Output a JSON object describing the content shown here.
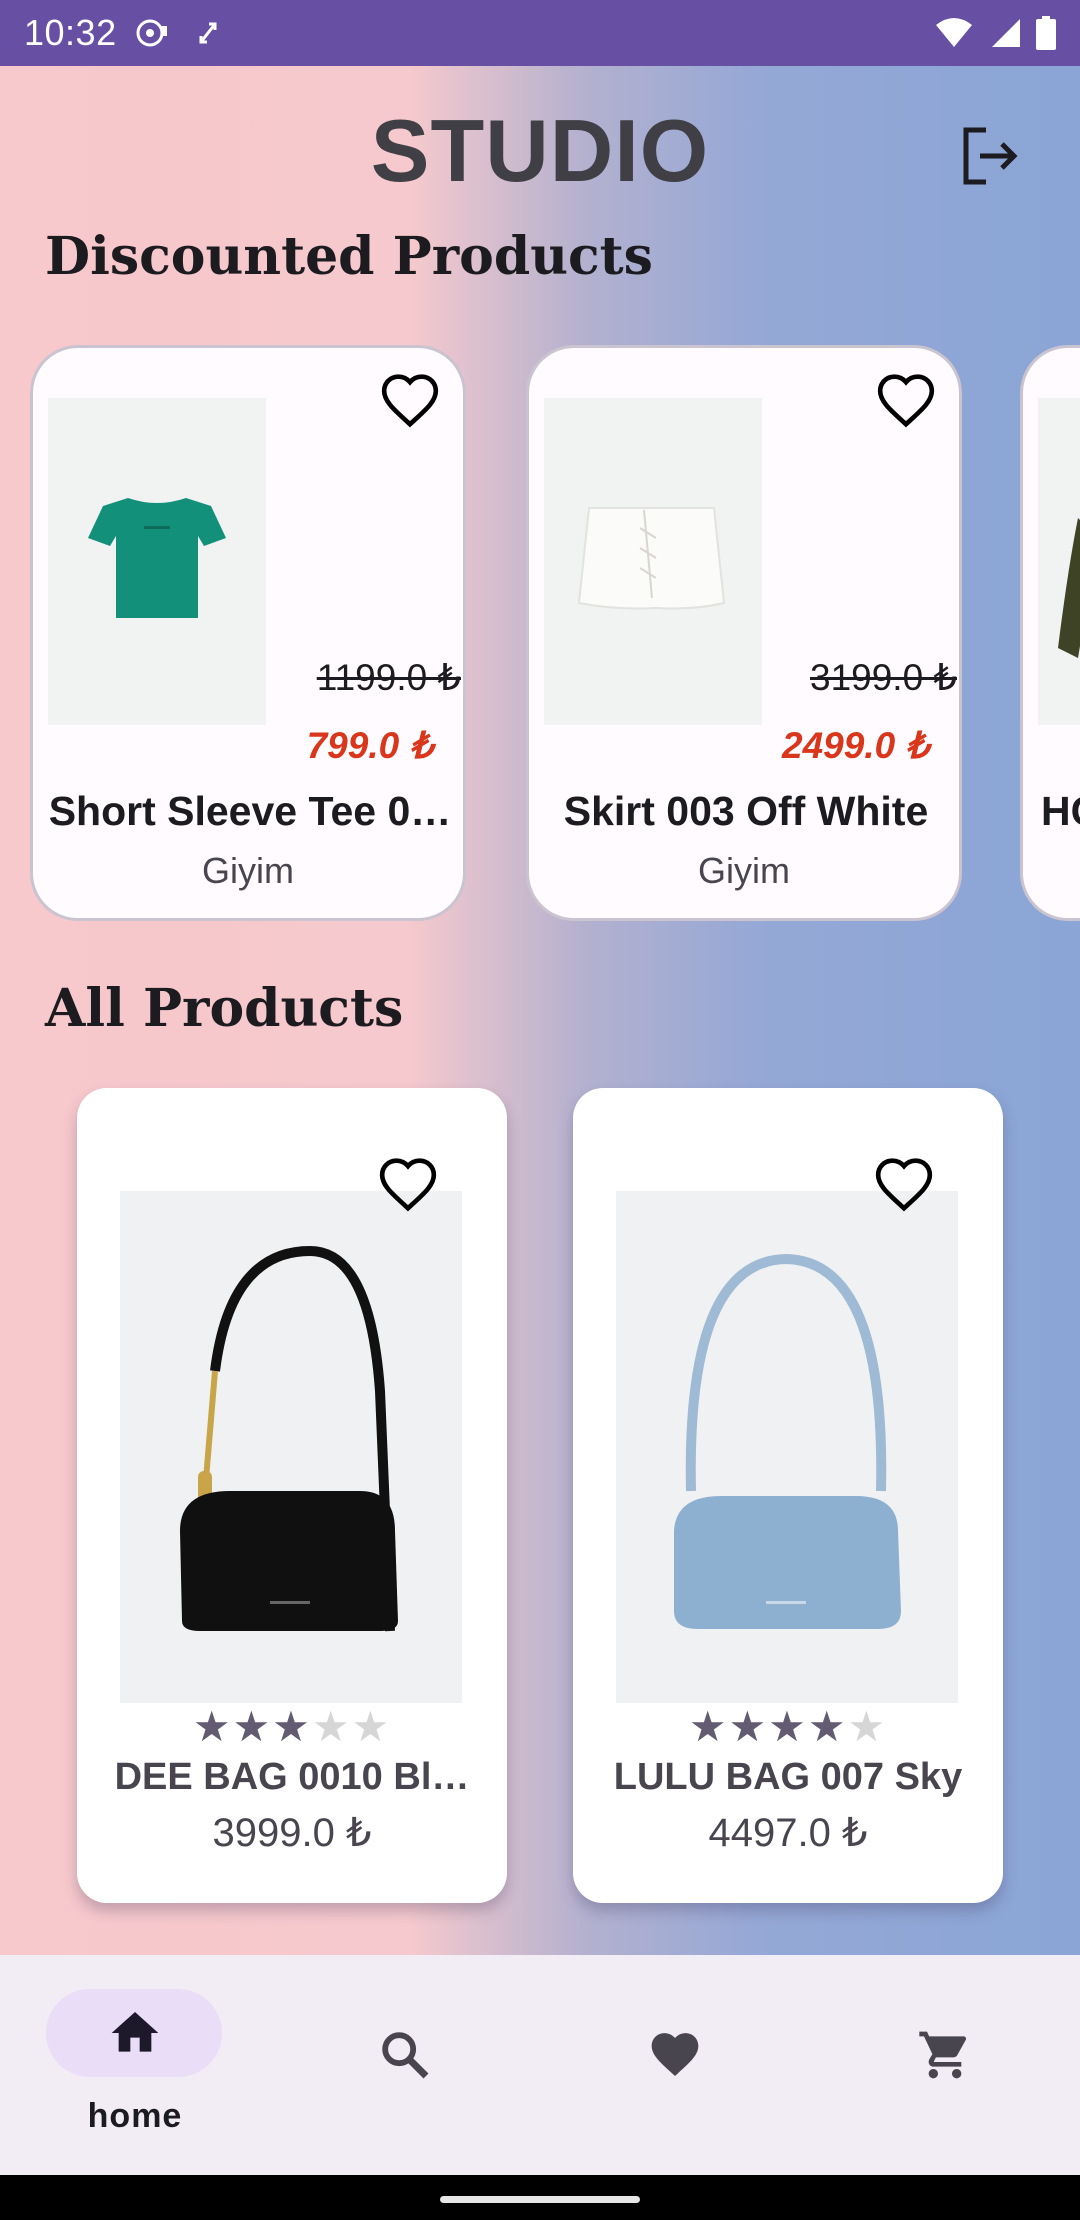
{
  "status_bar": {
    "time": "10:32",
    "icons": [
      "media-icon",
      "sync-icon",
      "wifi-icon",
      "signal-icon",
      "battery-icon"
    ],
    "color": "#6750a4"
  },
  "header": {
    "title": "STUDIO",
    "logout_icon": "logout-icon"
  },
  "discounted": {
    "title": "Discounted Products",
    "items": [
      {
        "name": "Short Sleeve Tee 0…",
        "category": "Giyim",
        "old_price": "1199.0 ₺",
        "new_price": "799.0 ₺",
        "image": "green t-shirt"
      },
      {
        "name": "Skirt 003 Off White",
        "category": "Giyim",
        "old_price": "3199.0 ₺",
        "new_price": "2499.0 ₺",
        "image": "white skirt"
      },
      {
        "name": "HC",
        "category": "",
        "old_price": "",
        "new_price": "",
        "image": "olive sweatshirt"
      }
    ]
  },
  "all_products": {
    "title": "All Products",
    "items": [
      {
        "name": "DEE BAG 0010 Bl…",
        "price": "3999.0 ₺",
        "rating": 3,
        "max_rating": 5,
        "image": "black shoulder bag"
      },
      {
        "name": "LULU BAG 007 Sky",
        "price": "4497.0 ₺",
        "rating": 4,
        "max_rating": 5,
        "image": "sky blue shoulder bag"
      }
    ]
  },
  "bottom_nav": {
    "items": [
      {
        "id": "home",
        "label": "home",
        "icon": "home-icon",
        "active": true
      },
      {
        "id": "search",
        "label": "",
        "icon": "search-icon",
        "active": false
      },
      {
        "id": "favorites",
        "label": "",
        "icon": "heart-icon",
        "active": false
      },
      {
        "id": "cart",
        "label": "",
        "icon": "cart-icon",
        "active": false
      }
    ]
  },
  "colors": {
    "accent": "#6750a4",
    "discount_price": "#d9361b",
    "nav_background": "#f2ecf5",
    "nav_pill": "#e9ddf7"
  }
}
